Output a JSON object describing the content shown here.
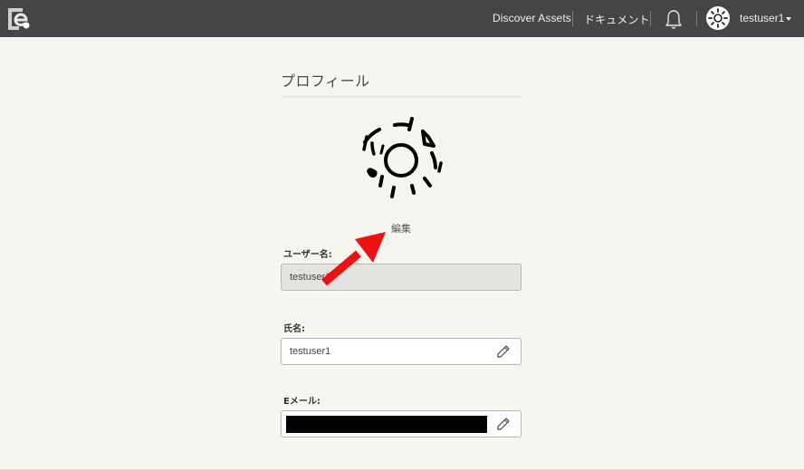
{
  "navbar": {
    "discover_label": "Discover Assets",
    "docs_label": "ドキュメント",
    "username": "testuser1"
  },
  "profile": {
    "title": "プロフィール",
    "edit_label": "編集",
    "username_label": "ユーザー名:",
    "username_value": "testuser1",
    "fullname_label": "氏名:",
    "fullname_value": "testuser1",
    "email_label": "Eメール:"
  },
  "colors": {
    "navbar_bg": "#454545",
    "page_bg": "#f6f5f0",
    "annotation_arrow": "#ee1111"
  },
  "icons": [
    "app-logo-icon",
    "bell-icon",
    "avatar-icon",
    "chevron-down-icon",
    "pencil-icon"
  ]
}
